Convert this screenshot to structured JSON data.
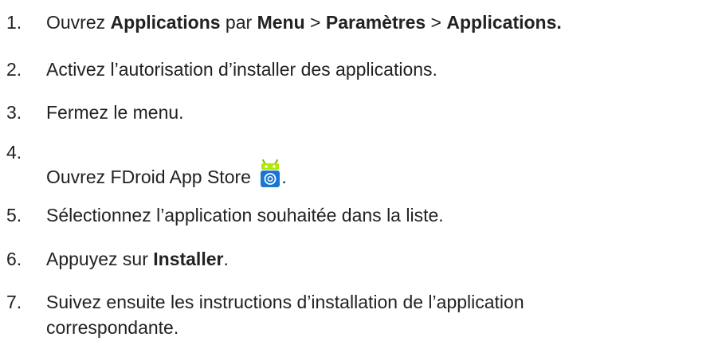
{
  "steps": [
    {
      "number": "1.",
      "parts": [
        "Ouvrez ",
        "Applications",
        " par  ",
        "Menu",
        " > ",
        "Paramètres",
        " > ",
        "Applications."
      ]
    },
    {
      "number": "2.",
      "text": "Activez l’autorisation d’installer des applications."
    },
    {
      "number": "3.",
      "text": "Fermez le menu."
    },
    {
      "number": "4.",
      "text": "Ouvrez FDroid App Store",
      "suffix": ".",
      "icon": "fdroid-app-icon"
    },
    {
      "number": "5.",
      "text": "Sélectionnez l’application souhaitée dans la liste."
    },
    {
      "number": "6.",
      "parts": [
        "Appuyez sur ",
        "Installer",
        "."
      ]
    },
    {
      "number": "7.",
      "line1": "Suivez ensuite les instructions d’installation de l’application",
      "line2": "correspondante."
    }
  ]
}
